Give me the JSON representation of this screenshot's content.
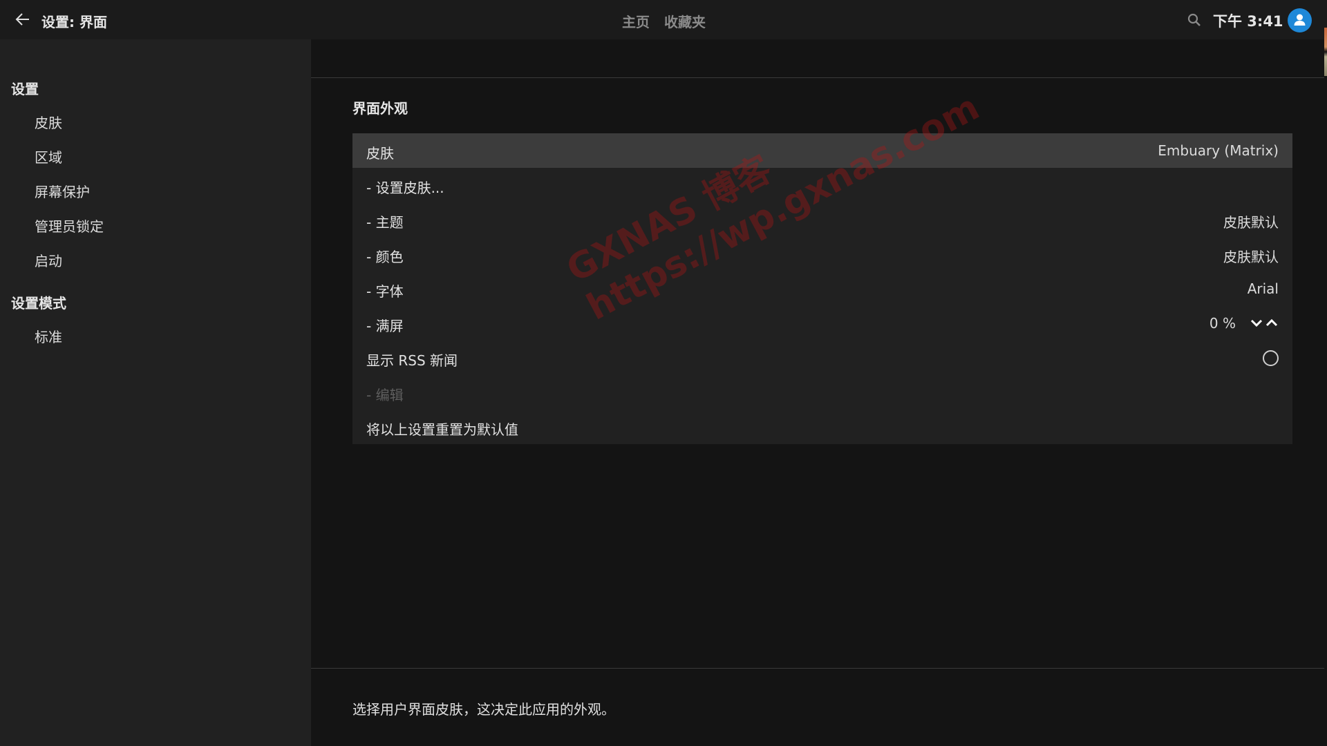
{
  "header": {
    "back_icon": "arrow-left-icon",
    "title": "设置: 界面",
    "nav": [
      "主页",
      "收藏夹"
    ],
    "search_icon": "search-icon",
    "clock": "下午 3:41",
    "avatar_icon": "user-icon",
    "accent_color": "#1e88d8"
  },
  "sidebar": {
    "groups": [
      {
        "heading": "设置",
        "items": [
          "皮肤",
          "区域",
          "屏幕保护",
          "管理员锁定",
          "启动"
        ]
      },
      {
        "heading": "设置模式",
        "items": [
          "标准"
        ]
      }
    ]
  },
  "main": {
    "section_title": "界面外观",
    "rows": [
      {
        "label": "皮肤",
        "value": "Embuary (Matrix)",
        "selected": true
      },
      {
        "label": "- 设置皮肤...",
        "value": ""
      },
      {
        "label": "- 主题",
        "value": "皮肤默认"
      },
      {
        "label": "- 颜色",
        "value": "皮肤默认"
      },
      {
        "label": "- 字体",
        "value": "Arial"
      },
      {
        "label": "- 满屏",
        "value": "0 %",
        "control": "spinner"
      },
      {
        "label": "显示 RSS 新闻",
        "value": "",
        "control": "radio",
        "checked": false
      },
      {
        "label": "- 编辑",
        "value": "",
        "disabled": true
      },
      {
        "label": "将以上设置重置为默认值",
        "value": ""
      }
    ],
    "description": "选择用户界面皮肤，这决定此应用的外观。"
  },
  "watermark": [
    "GXNAS 博客",
    "https://wp.gxnas.com"
  ]
}
